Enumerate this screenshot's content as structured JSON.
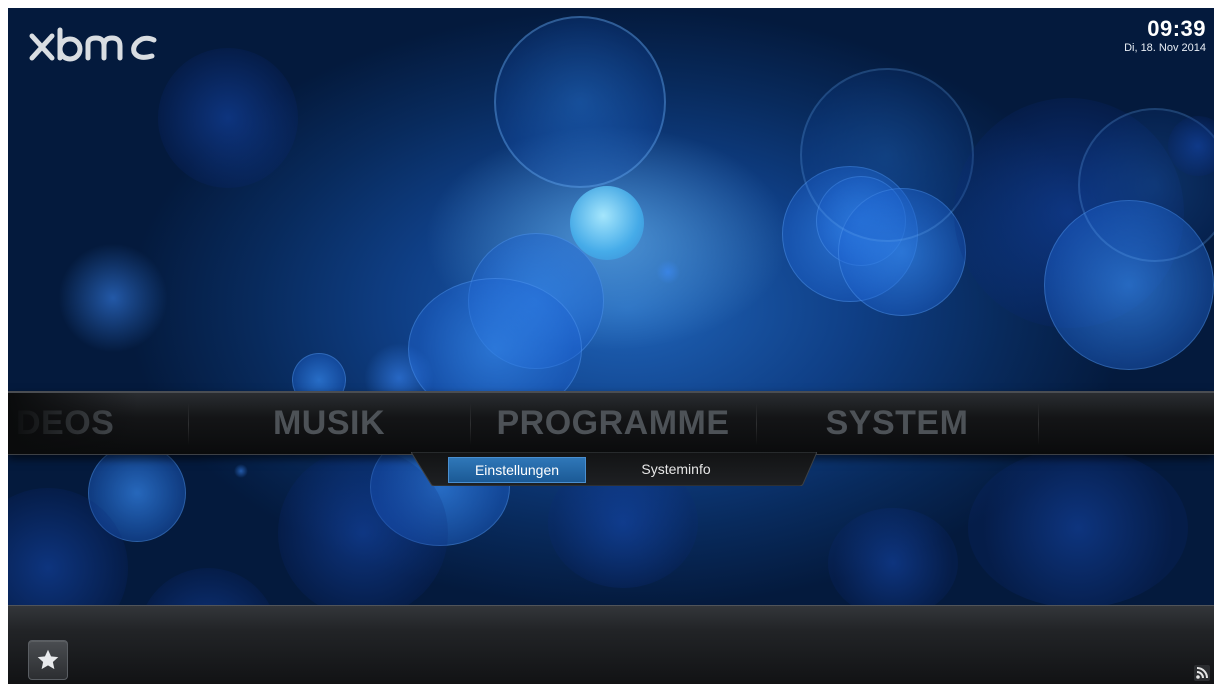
{
  "app": {
    "logo_text": "xbmc"
  },
  "clock": {
    "time": "09:39",
    "date": "Di, 18. Nov 2014"
  },
  "main_menu": {
    "items": [
      {
        "label": "DEOS",
        "state": "partial-offscreen"
      },
      {
        "label": "MUSIK"
      },
      {
        "label": "PROGRAMME"
      },
      {
        "label": "SYSTEM"
      }
    ]
  },
  "submenu": {
    "items": [
      {
        "label": "Einstellungen",
        "selected": true
      },
      {
        "label": "Systeminfo"
      }
    ]
  },
  "bottom_bar": {
    "favourites_icon": "star-icon",
    "rss_icon": "rss-icon"
  },
  "colors": {
    "background_blue": "#0f3f86",
    "selected_tab": "#2f77b8",
    "menu_text": "#4d5257",
    "bar_dark": "#141517"
  }
}
